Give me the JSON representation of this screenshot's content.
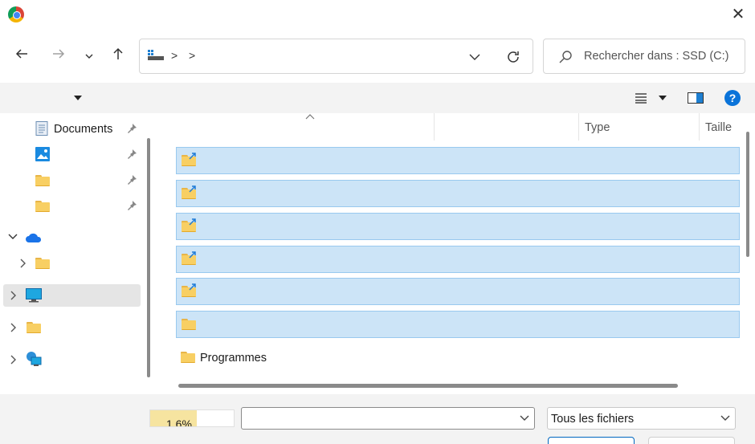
{
  "window": {
    "app_icon": "chrome-icon",
    "close_icon": "close-icon"
  },
  "nav": {
    "back_icon": "back-arrow-icon",
    "forward_icon": "forward-arrow-icon",
    "recent_icon": "chevron-down-icon",
    "up_icon": "up-arrow-icon",
    "refresh_icon": "refresh-icon"
  },
  "address": {
    "drive_icon": "drive-icon",
    "separators": [
      ">",
      ">"
    ]
  },
  "search": {
    "placeholder": "Rechercher dans : SSD (C:)"
  },
  "sidebar": {
    "items": [
      {
        "label": "Documents",
        "icon": "documents-icon",
        "pinned": true
      },
      {
        "label": "",
        "icon": "pictures-icon",
        "pinned": true
      },
      {
        "label": "",
        "icon": "folder-icon",
        "pinned": true
      },
      {
        "label": "",
        "icon": "folder-icon",
        "pinned": true
      },
      {
        "label": "",
        "icon": "onedrive-icon",
        "expanded": true
      },
      {
        "label": "",
        "icon": "folder-icon",
        "expanded": false
      },
      {
        "label": "",
        "icon": "this-pc-icon",
        "selected": true
      },
      {
        "label": "",
        "icon": "folder-icon"
      },
      {
        "label": "",
        "icon": "network-icon"
      }
    ]
  },
  "columns": [
    {
      "label": ""
    },
    {
      "label": ""
    },
    {
      "label": "Type"
    },
    {
      "label": "Taille"
    }
  ],
  "files": [
    {
      "label": "",
      "icon": "shortcut-folder-icon",
      "selected": true
    },
    {
      "label": "",
      "icon": "shortcut-folder-icon",
      "selected": true
    },
    {
      "label": "",
      "icon": "shortcut-folder-icon",
      "selected": true
    },
    {
      "label": "",
      "icon": "shortcut-folder-icon",
      "selected": true
    },
    {
      "label": "",
      "icon": "shortcut-folder-icon",
      "selected": true
    },
    {
      "label": "",
      "icon": "folder-icon",
      "selected": true
    },
    {
      "label": "Programmes",
      "icon": "folder-icon",
      "selected": false
    }
  ],
  "bottom": {
    "progress_text": "1.6%",
    "progress_value": 0.56,
    "filename_value": "",
    "filetype_value": "Tous les fichiers"
  },
  "colors": {
    "accent": "#0067c0",
    "selection": "#cce4f7",
    "folder": "#f8cf63",
    "help": "#0a73d9"
  }
}
